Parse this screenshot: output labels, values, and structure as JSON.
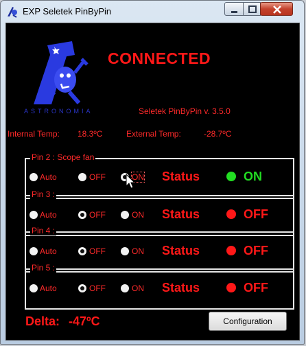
{
  "window": {
    "title": "EXP Seletek PinByPin"
  },
  "header": {
    "status_text": "CONNECTED",
    "logo_text": "ASTRONOMIA",
    "version": "Seletek PinByPin v. 3.5.0"
  },
  "temps": {
    "internal_label": "Internal Temp:",
    "internal_value": "18.3ºC",
    "external_label": "External Temp:",
    "external_value": "-28.7ºC"
  },
  "pins": [
    {
      "title": "Pin 2 : Scope fan",
      "auto": "Auto",
      "off": "OFF",
      "on": "ON",
      "selected": "ON",
      "status_label": "Status",
      "state": "ON",
      "state_color": "#22dd22"
    },
    {
      "title": "Pin 3 :",
      "auto": "Auto",
      "off": "OFF",
      "on": "ON",
      "selected": "OFF",
      "status_label": "Status",
      "state": "OFF",
      "state_color": "#ff1818"
    },
    {
      "title": "Pin 4 :",
      "auto": "Auto",
      "off": "OFF",
      "on": "ON",
      "selected": "OFF",
      "status_label": "Status",
      "state": "OFF",
      "state_color": "#ff1818"
    },
    {
      "title": "Pin 5 :",
      "auto": "Auto",
      "off": "OFF",
      "on": "ON",
      "selected": "OFF",
      "status_label": "Status",
      "state": "OFF",
      "state_color": "#ff1818"
    }
  ],
  "footer": {
    "delta_label": "Delta:",
    "delta_value": "-47ºC",
    "config_button": "Configuration"
  }
}
